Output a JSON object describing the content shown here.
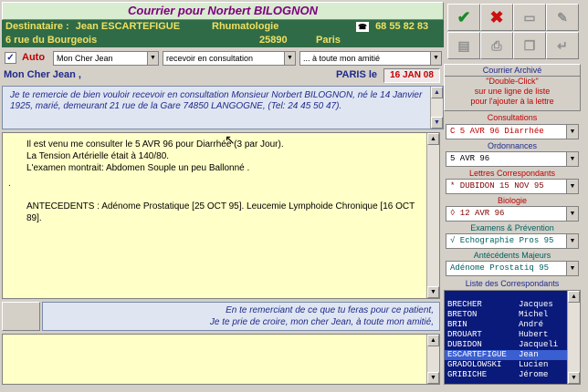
{
  "title": "Courrier pour Norbert BILOGNON",
  "recipient": {
    "label": "Destinataire :",
    "name": "Jean ESCARTEFIGUE",
    "specialty": "Rhumatologie",
    "phone": "68 55 82 83",
    "address": "6 rue du Bourgeois",
    "postal_code": "25890",
    "city": "Paris"
  },
  "options": {
    "auto_label": "Auto",
    "salutation": "Mon Cher Jean",
    "opening": "recevoir en consultation",
    "closing": "... à toute mon amitié"
  },
  "letter": {
    "greeting": "Mon Cher Jean ,",
    "place_prefix": "PARIS le",
    "date": "16 JAN 08",
    "intro": "Je te remercie de bien vouloir recevoir en consultation Monsieur Norbert BILOGNON, né le 14 Janvier 1925,  marié, demeurant 21 rue de la Gare 74850 LANGOGNE, (Tel: 24 45 50 47).",
    "body_lines": [
      "Il est venu me consulter le 5 AVR 96 pour Diarrhée (3 par Jour).",
      "La Tension Artérielle était à 140/80.",
      "L'examen montrait: Abdomen Souple un peu Ballonné .",
      ".",
      "ANTECEDENTS : Adénome Prostatique [25 OCT 95]. Leucemie Lymphoide Chronique [16 OCT 89]."
    ],
    "closing_line1": "En te remerciant de ce que tu feras pour ce patient,",
    "closing_line2": "Je te prie de croire, mon cher Jean, à toute mon amitié,"
  },
  "archive": {
    "title": "Courrier Archivé",
    "hint_line1": "\"Double-Click\"",
    "hint_line2": "sur une ligne de liste",
    "hint_line3": "pour l'ajouter à la lettre"
  },
  "sections": {
    "consultations": {
      "label": "Consultations",
      "value": "C  5 AVR 96 Diarrhée"
    },
    "ordonnances": {
      "label": "Ordonnances",
      "value": "5 AVR 96"
    },
    "lettres": {
      "label": "Lettres Correspondants",
      "value": "* DUBIDON   15 NOV 95"
    },
    "biologie": {
      "label": "Biologie",
      "value": "◊  12 AVR 96"
    },
    "examens": {
      "label": "Examens & Prévention",
      "value": "√ Echographie Pros 95"
    },
    "antecedents": {
      "label": "Antécédents Majeurs",
      "value": "Adénome Prostatiq 95"
    },
    "correspondants_label": "Liste des Correspondants"
  },
  "correspondants": [
    {
      "last": "BRECHER",
      "first": "Jacques"
    },
    {
      "last": "BRETON",
      "first": "Michel"
    },
    {
      "last": "BRIN",
      "first": "André"
    },
    {
      "last": "DROUART",
      "first": "Hubert"
    },
    {
      "last": "DUBIDON",
      "first": "Jacqueli"
    },
    {
      "last": "ESCARTEFIGUE",
      "first": "Jean"
    },
    {
      "last": "GRADOLOWSKI",
      "first": "Lucien"
    },
    {
      "last": "GRIBICHE",
      "first": "Jérome"
    }
  ],
  "selected_correspondant_index": 5,
  "colors": {
    "title_text": "#800080",
    "header_green": "#2f6b47",
    "validate_green": "#1a8a2a",
    "cancel_red": "#cc1010",
    "list_bg": "#0a1a7a"
  }
}
